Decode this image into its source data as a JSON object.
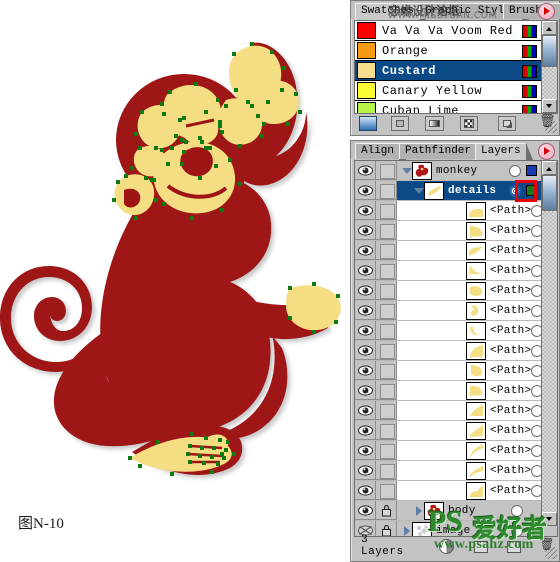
{
  "caption": "图N-10",
  "colors": {
    "artwork_red": "#9e1414",
    "artwork_yellow": "#f5dd83",
    "anchor_green": "#0f7a0f",
    "selection_blue": "#0b4a87",
    "panel_gray": "#c3c3c3",
    "highlight_red": "#e60000",
    "layer_color_green": "#1a7a1a",
    "layer_color_blue": "#1a3ab5"
  },
  "swatches_panel": {
    "tabs": [
      {
        "label": "Swatches",
        "active": true
      },
      {
        "label": "Graphic Styles",
        "active": false
      },
      {
        "label": "Brushes",
        "active": false
      }
    ],
    "menu_icon": "panel-menu-icon",
    "rows": [
      {
        "name": "Va Va Va Voom Red",
        "color": "#ff0000",
        "selected": false,
        "mode_icon": "rgb-mode-icon"
      },
      {
        "name": "Orange",
        "color": "#f59a12",
        "selected": false,
        "mode_icon": "rgb-mode-icon"
      },
      {
        "name": "Custard",
        "color": "#f7dd8e",
        "selected": true,
        "mode_icon": "rgb-mode-icon"
      },
      {
        "name": "Canary Yellow",
        "color": "#fbfb36",
        "selected": false,
        "mode_icon": "rgb-mode-icon"
      },
      {
        "name": "Cuban Lime",
        "color": "#b7f24a",
        "selected": false,
        "mode_icon": "rgb-mode-icon"
      }
    ],
    "toolbar": [
      {
        "icon": "swatch-libraries-icon",
        "active": true
      },
      {
        "icon": "show-color-swatches-icon",
        "active": false
      },
      {
        "icon": "show-gradient-swatches-icon",
        "active": false
      },
      {
        "icon": "show-pattern-swatches-icon",
        "active": false
      },
      {
        "icon": "new-swatch-icon",
        "active": false
      },
      {
        "icon": "delete-swatch-trash-icon",
        "active": false
      }
    ],
    "scrollbar": {
      "up_icon": "scroll-up-arrow-icon",
      "down_icon": "scroll-down-arrow-icon"
    }
  },
  "layers_panel": {
    "tabs": [
      {
        "label": "Align",
        "active": false
      },
      {
        "label": "Pathfinder",
        "active": false
      },
      {
        "label": "Layers",
        "active": true
      }
    ],
    "menu_icon": "panel-menu-icon",
    "status": "3 Layers",
    "rows": [
      {
        "name": "monkey",
        "type": "layer",
        "depth": 0,
        "expanded": true,
        "visible": true,
        "locked": false,
        "selected": false,
        "targeted": false,
        "color": "#1a3ab5",
        "has_selection_square": true,
        "thumb": "monkey-thumbnail"
      },
      {
        "name": "details",
        "type": "sublayer",
        "depth": 1,
        "expanded": true,
        "visible": true,
        "locked": false,
        "selected": true,
        "targeted": true,
        "color": "#1a7a1a",
        "has_selection_square": true,
        "thumb": "details-thumbnail"
      },
      {
        "name": "<Path>",
        "type": "path",
        "depth": 2,
        "visible": true,
        "locked": false,
        "selected": false,
        "targeted": false,
        "color": "#1a7a1a",
        "has_selection_square": true,
        "thumb": "path-thumbnail-1"
      },
      {
        "name": "<Path>",
        "type": "path",
        "depth": 2,
        "visible": true,
        "locked": false,
        "selected": false,
        "targeted": false,
        "color": "#1a7a1a",
        "has_selection_square": true,
        "thumb": "path-thumbnail-2"
      },
      {
        "name": "<Path>",
        "type": "path",
        "depth": 2,
        "visible": true,
        "locked": false,
        "selected": false,
        "targeted": false,
        "color": "#1a7a1a",
        "has_selection_square": true,
        "thumb": "path-thumbnail-3"
      },
      {
        "name": "<Path>",
        "type": "path",
        "depth": 2,
        "visible": true,
        "locked": false,
        "selected": false,
        "targeted": false,
        "color": "#1a7a1a",
        "has_selection_square": true,
        "thumb": "path-thumbnail-4"
      },
      {
        "name": "<Path>",
        "type": "path",
        "depth": 2,
        "visible": true,
        "locked": false,
        "selected": false,
        "targeted": false,
        "color": "#1a7a1a",
        "has_selection_square": true,
        "thumb": "path-thumbnail-5"
      },
      {
        "name": "<Path>",
        "type": "path",
        "depth": 2,
        "visible": true,
        "locked": false,
        "selected": false,
        "targeted": false,
        "color": "#1a7a1a",
        "has_selection_square": true,
        "thumb": "path-thumbnail-6"
      },
      {
        "name": "<Path>",
        "type": "path",
        "depth": 2,
        "visible": true,
        "locked": false,
        "selected": false,
        "targeted": false,
        "color": "#1a7a1a",
        "has_selection_square": true,
        "thumb": "path-thumbnail-7"
      },
      {
        "name": "<Path>",
        "type": "path",
        "depth": 2,
        "visible": true,
        "locked": false,
        "selected": false,
        "targeted": false,
        "color": "#1a7a1a",
        "has_selection_square": true,
        "thumb": "path-thumbnail-8"
      },
      {
        "name": "<Path>",
        "type": "path",
        "depth": 2,
        "visible": true,
        "locked": false,
        "selected": false,
        "targeted": false,
        "color": "#1a7a1a",
        "has_selection_square": true,
        "thumb": "path-thumbnail-9"
      },
      {
        "name": "<Path>",
        "type": "path",
        "depth": 2,
        "visible": true,
        "locked": false,
        "selected": false,
        "targeted": false,
        "color": "#1a7a1a",
        "has_selection_square": true,
        "thumb": "path-thumbnail-10"
      },
      {
        "name": "<Path>",
        "type": "path",
        "depth": 2,
        "visible": true,
        "locked": false,
        "selected": false,
        "targeted": false,
        "color": "#1a7a1a",
        "has_selection_square": true,
        "thumb": "path-thumbnail-11"
      },
      {
        "name": "<Path>",
        "type": "path",
        "depth": 2,
        "visible": true,
        "locked": false,
        "selected": false,
        "targeted": false,
        "color": "#1a7a1a",
        "has_selection_square": true,
        "thumb": "path-thumbnail-12"
      },
      {
        "name": "<Path>",
        "type": "path",
        "depth": 2,
        "visible": true,
        "locked": false,
        "selected": false,
        "targeted": false,
        "color": "#1a7a1a",
        "has_selection_square": true,
        "thumb": "path-thumbnail-13"
      },
      {
        "name": "<Path>",
        "type": "path",
        "depth": 2,
        "visible": true,
        "locked": false,
        "selected": false,
        "targeted": false,
        "color": "#1a7a1a",
        "has_selection_square": true,
        "thumb": "path-thumbnail-14"
      },
      {
        "name": "<Path>",
        "type": "path",
        "depth": 2,
        "visible": true,
        "locked": false,
        "selected": false,
        "targeted": false,
        "color": "#1a7a1a",
        "has_selection_square": true,
        "thumb": "path-thumbnail-15"
      },
      {
        "name": "body",
        "type": "sublayer",
        "depth": 1,
        "expanded": false,
        "visible": true,
        "locked": true,
        "selected": false,
        "targeted": false,
        "color": "",
        "has_selection_square": false,
        "thumb": "body-thumbnail"
      },
      {
        "name": "image",
        "type": "layer",
        "depth": 0,
        "expanded": false,
        "visible": false,
        "locked": true,
        "selected": false,
        "targeted": false,
        "color": "",
        "has_selection_square": false,
        "thumb": "image-thumbnail"
      }
    ],
    "toolbar": [
      {
        "icon": "make-clipping-mask-icon"
      },
      {
        "icon": "create-new-sublayer-icon"
      },
      {
        "icon": "create-new-layer-icon"
      },
      {
        "icon": "delete-selection-trash-icon"
      }
    ],
    "target_highlight": {
      "icon": "target-indicator-highlight",
      "color": "#e60000"
    }
  },
  "watermarks": {
    "top": {
      "line1": "忘缘设计论坛",
      "line2": "WWW.MISSYUAN.COM"
    },
    "bottom": {
      "ps": "PS",
      "chinese": "爱好者",
      "url": "www.psahz.com"
    }
  }
}
